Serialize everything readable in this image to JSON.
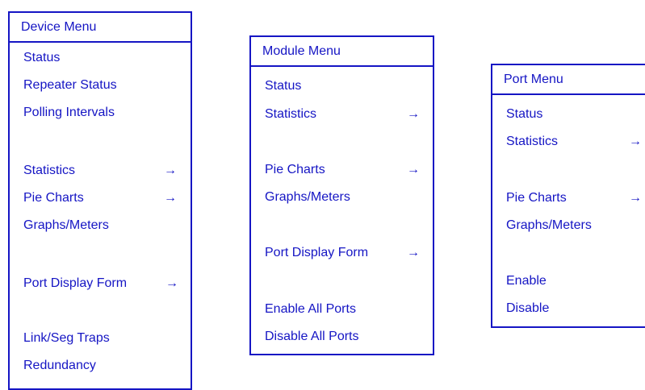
{
  "colors": {
    "menu_text": "#1515c4",
    "menu_border": "#1515c4",
    "background": "#ffffff"
  },
  "device_menu": {
    "title": "Device Menu",
    "items": [
      {
        "label": "Status",
        "arrow": ""
      },
      {
        "label": "Repeater Status",
        "arrow": ""
      },
      {
        "label": "Polling Intervals",
        "arrow": ""
      },
      {
        "label": "Statistics",
        "arrow": "→"
      },
      {
        "label": "Pie Charts",
        "arrow": "→"
      },
      {
        "label": "Graphs/Meters",
        "arrow": ""
      },
      {
        "label": "Port Display Form",
        "arrow": "→"
      },
      {
        "label": "Link/Seg Traps",
        "arrow": ""
      },
      {
        "label": "Redundancy",
        "arrow": ""
      }
    ]
  },
  "module_menu": {
    "title": "Module Menu",
    "items": [
      {
        "label": "Status",
        "arrow": ""
      },
      {
        "label": "Statistics",
        "arrow": "→"
      },
      {
        "label": "Pie Charts",
        "arrow": "→"
      },
      {
        "label": "Graphs/Meters",
        "arrow": ""
      },
      {
        "label": "Port Display Form",
        "arrow": "→"
      },
      {
        "label": "Enable All Ports",
        "arrow": ""
      },
      {
        "label": "Disable All Ports",
        "arrow": ""
      }
    ]
  },
  "port_menu": {
    "title": "Port Menu",
    "items": [
      {
        "label": "Status",
        "arrow": ""
      },
      {
        "label": "Statistics",
        "arrow": "→"
      },
      {
        "label": "Pie Charts",
        "arrow": "→"
      },
      {
        "label": "Graphs/Meters",
        "arrow": ""
      },
      {
        "label": "Enable",
        "arrow": ""
      },
      {
        "label": "Disable",
        "arrow": ""
      }
    ]
  }
}
